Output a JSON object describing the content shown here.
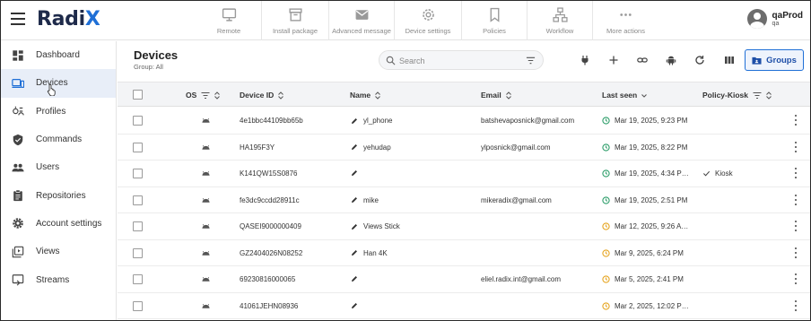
{
  "app": {
    "name_main": "Radi",
    "name_accent": "X"
  },
  "toolbar": {
    "actions": [
      {
        "label": "Remote",
        "icon": "monitor-icon"
      },
      {
        "label": "Install package",
        "icon": "package-icon"
      },
      {
        "label": "Advanced message",
        "icon": "envelope-icon"
      },
      {
        "label": "Device settings",
        "icon": "gear-icon"
      },
      {
        "label": "Policies",
        "icon": "bookmark-icon"
      },
      {
        "label": "Workflow",
        "icon": "workflow-icon"
      },
      {
        "label": "More actions",
        "icon": "more-dots-icon"
      }
    ]
  },
  "user": {
    "name": "qaProd",
    "org": "qa"
  },
  "sidebar": {
    "items": [
      {
        "label": "Dashboard",
        "icon": "dashboard-icon",
        "active": false
      },
      {
        "label": "Devices",
        "icon": "devices-icon",
        "active": true
      },
      {
        "label": "Profiles",
        "icon": "profiles-icon",
        "active": false
      },
      {
        "label": "Commands",
        "icon": "shield-icon",
        "active": false
      },
      {
        "label": "Users",
        "icon": "users-icon",
        "active": false
      },
      {
        "label": "Repositories",
        "icon": "clipboard-icon",
        "active": false
      },
      {
        "label": "Account settings",
        "icon": "gear-icon",
        "active": false
      },
      {
        "label": "Views",
        "icon": "views-icon",
        "active": false
      },
      {
        "label": "Streams",
        "icon": "streams-icon",
        "active": false
      }
    ]
  },
  "page": {
    "title": "Devices",
    "subtitle": "Group: All"
  },
  "search": {
    "placeholder": "Search",
    "value": ""
  },
  "buttons": {
    "groups": "Groups"
  },
  "table": {
    "columns": {
      "os": "OS",
      "device_id": "Device ID",
      "name": "Name",
      "email": "Email",
      "last_seen": "Last seen",
      "policy": "Policy-Kiosk"
    },
    "rows": [
      {
        "device_id": "4e1bbc44109bb65b",
        "name": "yl_phone",
        "email": "batshevaposnick@gmail.com",
        "last_seen": "Mar 19, 2025, 9:23 PM",
        "seen_status": "green",
        "policy": ""
      },
      {
        "device_id": "HA195F3Y",
        "name": "yehudap",
        "email": "ylposnick@gmail.com",
        "last_seen": "Mar 19, 2025, 8:22 PM",
        "seen_status": "green",
        "policy": ""
      },
      {
        "device_id": "K141QW15S0876",
        "name": "",
        "email": "",
        "last_seen": "Mar 19, 2025, 4:34 P…",
        "seen_status": "green",
        "policy": "Kiosk"
      },
      {
        "device_id": "fe3dc9ccdd28911c",
        "name": "mike",
        "email": "mikeradix@gmail.com",
        "last_seen": "Mar 19, 2025, 2:51 PM",
        "seen_status": "green",
        "policy": ""
      },
      {
        "device_id": "QASEI9000000409",
        "name": "Views Stick",
        "email": "",
        "last_seen": "Mar 12, 2025, 9:26 A…",
        "seen_status": "amber",
        "policy": ""
      },
      {
        "device_id": "GZ2404026N08252",
        "name": "Han 4K",
        "email": "",
        "last_seen": "Mar 9, 2025, 6:24 PM",
        "seen_status": "amber",
        "policy": ""
      },
      {
        "device_id": "69230816000065",
        "name": "",
        "email": "eliel.radix.int@gmail.com",
        "last_seen": "Mar 5, 2025, 2:41 PM",
        "seen_status": "amber",
        "policy": ""
      },
      {
        "device_id": "41061JEHN08936",
        "name": "",
        "email": "",
        "last_seen": "Mar 2, 2025, 12:02 P…",
        "seen_status": "amber",
        "policy": ""
      }
    ]
  },
  "colors": {
    "accent": "#1f6fd6",
    "status_green": "#2e9e6a",
    "status_amber": "#e6a521",
    "active_bg": "#e8eef8"
  }
}
